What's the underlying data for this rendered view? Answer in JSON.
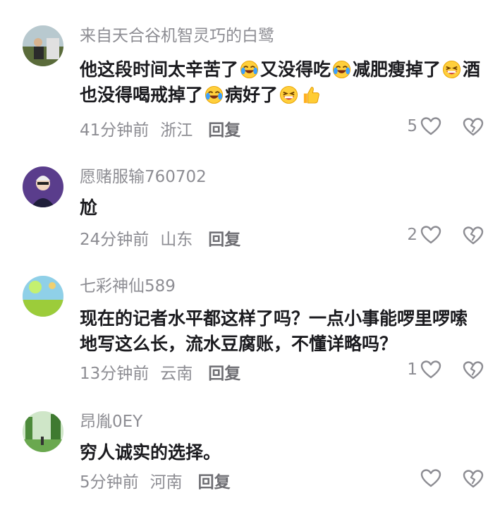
{
  "comments": [
    {
      "username": "来自天合谷机智灵巧的白鹭",
      "content_parts": [
        "他这段时间太辛苦了",
        "又没得吃",
        "减肥瘦掉了",
        "酒也没得喝戒掉了",
        "病好了"
      ],
      "time": "41分钟前",
      "location": "浙江",
      "reply": "回复",
      "likes": "5"
    },
    {
      "username": "愿赌服输760702",
      "content": "尬",
      "time": "24分钟前",
      "location": "山东",
      "reply": "回复",
      "likes": "2"
    },
    {
      "username": "七彩神仙589",
      "content": "现在的记者水平都这样了吗？一点小事能啰里啰嗦地写这么长，流水豆腐账，不懂详略吗？",
      "time": "13分钟前",
      "location": "云南",
      "reply": "回复",
      "likes": "1"
    },
    {
      "username": "昂胤0EY",
      "content": "穷人诚实的选择。",
      "time": "5分钟前",
      "location": "河南",
      "reply": "回复",
      "likes": ""
    }
  ],
  "icons": {
    "like": "heart-outline-icon",
    "dislike": "broken-heart-icon",
    "emoji_cry": "crying-laughing-emoji",
    "emoji_grin": "grinning-squint-emoji",
    "emoji_thumb": "thumbs-up-emoji"
  },
  "colors": {
    "text": "#1b1b1f",
    "muted": "#8d8d93",
    "icon": "#8d8d93"
  }
}
